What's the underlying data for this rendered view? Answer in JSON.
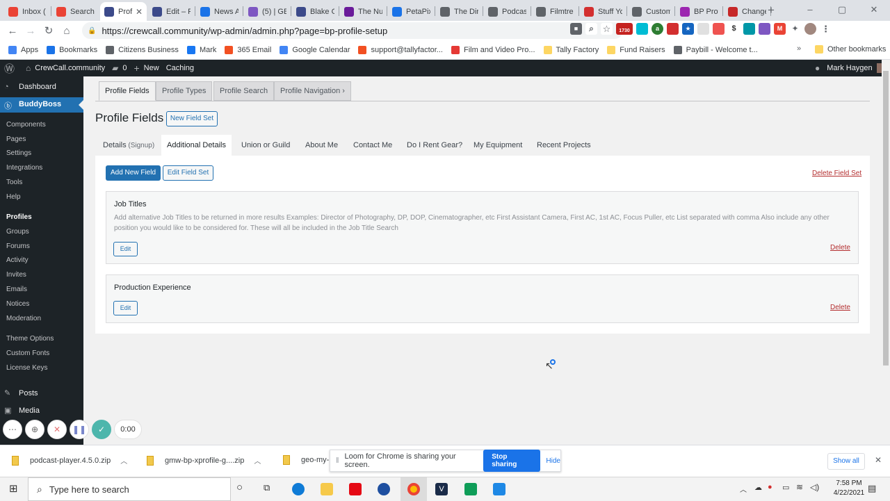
{
  "browser": {
    "tabs": [
      {
        "title": "Inbox (",
        "color": "#ea4335"
      },
      {
        "title": "Search",
        "color": "#ea4335"
      },
      {
        "title": "Prof",
        "color": "#3c4a8a",
        "active": true
      },
      {
        "title": "Edit – P",
        "color": "#3c4a8a"
      },
      {
        "title": "News A",
        "color": "#1a73e8"
      },
      {
        "title": "(5) | GE",
        "color": "#7e57c2"
      },
      {
        "title": "Blake G",
        "color": "#3c4a8a"
      },
      {
        "title": "The Nu",
        "color": "#6a1b9a"
      },
      {
        "title": "PetaPix",
        "color": "#1a73e8"
      },
      {
        "title": "The Dir",
        "color": "#5f6368"
      },
      {
        "title": "Podcast",
        "color": "#5f6368"
      },
      {
        "title": "Filmtre",
        "color": "#5f6368"
      },
      {
        "title": "Stuff Yo",
        "color": "#d32f2f"
      },
      {
        "title": "Custom",
        "color": "#5f6368"
      },
      {
        "title": "BP Prof",
        "color": "#9c27b0"
      },
      {
        "title": "Change",
        "color": "#c62828"
      }
    ],
    "url": "https://crewcall.community/wp-admin/admin.php?page=bp-profile-setup",
    "gmail_badge": "1730",
    "bookmarks": [
      {
        "label": "Apps",
        "color": "#4285f4"
      },
      {
        "label": "Bookmarks",
        "color": "#1a73e8"
      },
      {
        "label": "Citizens Business",
        "color": "#5f6368"
      },
      {
        "label": "Mark",
        "color": "#1877f2"
      },
      {
        "label": "365 Email",
        "color": "#f25022"
      },
      {
        "label": "Google Calendar",
        "color": "#4285f4"
      },
      {
        "label": "support@tallyfactor...",
        "color": "#f25022"
      },
      {
        "label": "Film and Video Pro...",
        "color": "#e53935"
      },
      {
        "label": "Tally Factory",
        "color": "#fdd663"
      },
      {
        "label": "Fund Raisers",
        "color": "#fdd663"
      },
      {
        "label": "Paybill - Welcome t...",
        "color": "#5f6368"
      }
    ],
    "other_bookmarks": "Other bookmarks"
  },
  "adminbar": {
    "site": "CrewCall.community",
    "comments": "0",
    "new": "New",
    "caching": "Caching",
    "user": "Mark Haygen"
  },
  "sidebar": {
    "dashboard": "Dashboard",
    "buddyboss": "BuddyBoss",
    "submenu": [
      "Components",
      "Pages",
      "Settings",
      "Integrations",
      "Tools",
      "Help",
      "Profiles",
      "Groups",
      "Forums",
      "Activity",
      "Invites",
      "Emails",
      "Notices",
      "Moderation",
      "Theme Options",
      "Custom Fonts",
      "License Keys"
    ],
    "posts": "Posts",
    "media": "Media"
  },
  "main": {
    "top_tabs": [
      "Profile Fields",
      "Profile Types",
      "Profile Search",
      "Profile Navigation"
    ],
    "title": "Profile Fields",
    "new_field_set": "New Field Set",
    "fieldset_tabs": [
      {
        "label": "Details",
        "suffix": "(Signup)"
      },
      {
        "label": "Additional Details",
        "suffix": ""
      },
      {
        "label": "Union or Guild",
        "suffix": ""
      },
      {
        "label": "About Me",
        "suffix": ""
      },
      {
        "label": "Contact Me",
        "suffix": ""
      },
      {
        "label": "Do I Rent Gear?",
        "suffix": ""
      },
      {
        "label": "My Equipment",
        "suffix": ""
      },
      {
        "label": "Recent Projects",
        "suffix": ""
      }
    ],
    "add_new_field": "Add New Field",
    "edit_field_set": "Edit Field Set",
    "delete_field_set": "Delete Field Set",
    "fields": [
      {
        "title": "Job Titles",
        "description": "Add alternative Job Titles to be returned in more results Examples: Director of Photography, DP, DOP, Cinematographer, etc First Assistant Camera, First AC, 1st AC, Focus Puller, etc List separated with comma Also include any other position you would like to be considered for. These will all be included in the Job Title Search",
        "edit": "Edit",
        "delete": "Delete"
      },
      {
        "title": "Production Experience",
        "description": "",
        "edit": "Edit",
        "delete": "Delete"
      }
    ]
  },
  "loom": {
    "timer": "0:00",
    "notice": "Loom for Chrome is sharing your screen.",
    "stop": "Stop sharing",
    "hide": "Hide"
  },
  "downloads": {
    "items": [
      "podcast-player.4.5.0.zip",
      "gmw-bp-xprofile-g....zip",
      "geo-my-"
    ],
    "show_all": "Show all"
  },
  "taskbar": {
    "search_placeholder": "Type here to search",
    "time": "7:58 PM",
    "date": "4/22/2021"
  }
}
